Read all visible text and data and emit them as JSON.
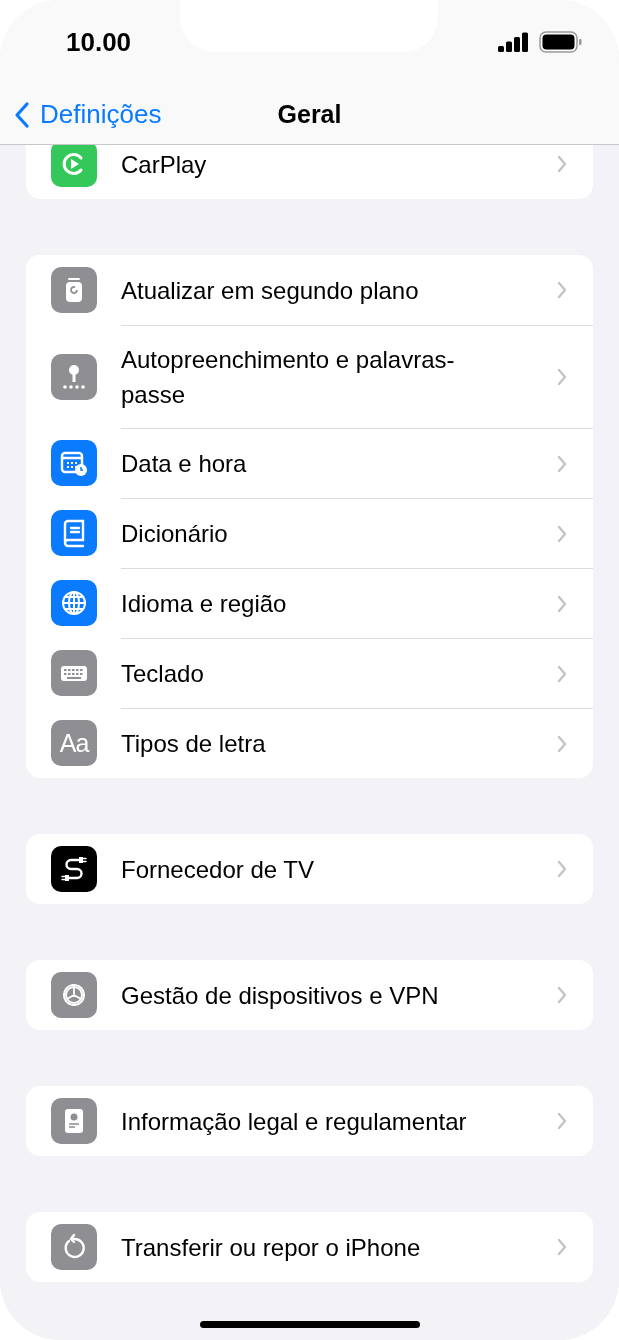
{
  "status_bar": {
    "time": "10.00"
  },
  "nav": {
    "back": "Definições",
    "title": "Geral"
  },
  "groups": [
    {
      "items": [
        {
          "kind": "carplay",
          "color": "#34c759",
          "label": "CarPlay"
        }
      ]
    },
    {
      "items": [
        {
          "kind": "refresh",
          "color": "#8e8e93",
          "label": "Atualizar em segundo plano"
        },
        {
          "kind": "key",
          "color": "#8e8e93",
          "label": "Autopreenchimento e palavras-passe"
        },
        {
          "kind": "calendar",
          "color": "#0a7aff",
          "label": "Data e hora"
        },
        {
          "kind": "book",
          "color": "#0a7aff",
          "label": "Dicionário"
        },
        {
          "kind": "globe",
          "color": "#0a7aff",
          "label": "Idioma e região"
        },
        {
          "kind": "keyboard",
          "color": "#8e8e93",
          "label": "Teclado"
        },
        {
          "kind": "font",
          "color": "#8e8e93",
          "label": "Tipos de letra",
          "icon_text": "Aa"
        }
      ]
    },
    {
      "items": [
        {
          "kind": "cable",
          "color": "#000000",
          "label": "Fornecedor de TV"
        }
      ]
    },
    {
      "items": [
        {
          "kind": "gear",
          "color": "#8e8e93",
          "label": "Gestão de dispositivos e VPN"
        }
      ]
    },
    {
      "items": [
        {
          "kind": "certificate",
          "color": "#8e8e93",
          "label": "Informação legal e regulamentar"
        }
      ]
    },
    {
      "items": [
        {
          "kind": "reset",
          "color": "#8e8e93",
          "label": "Transferir ou repor o iPhone"
        }
      ]
    }
  ]
}
